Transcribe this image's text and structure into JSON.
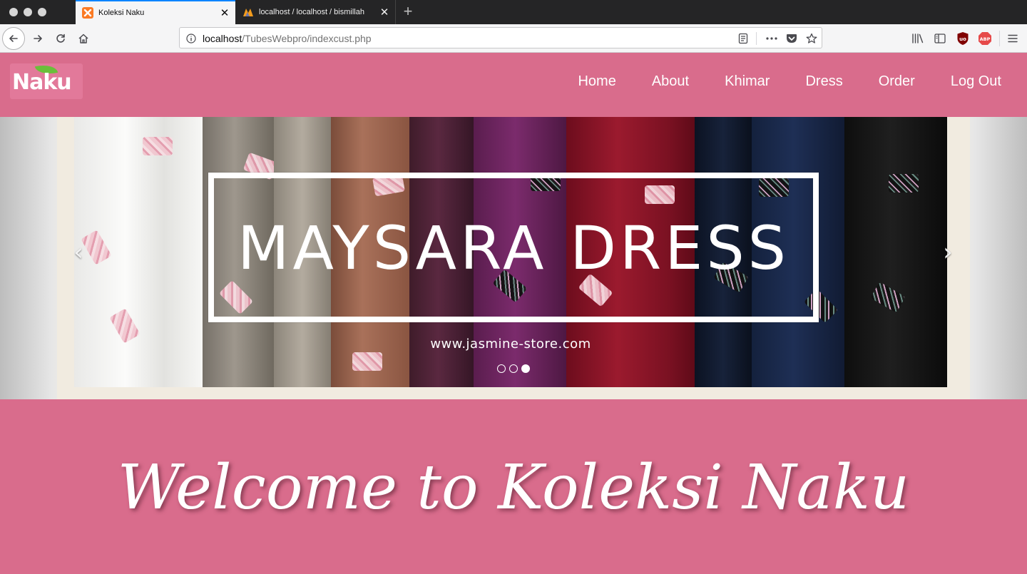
{
  "browser": {
    "tabs": [
      {
        "title": "Koleksi Naku",
        "active": true,
        "favicon": "xampp-icon"
      },
      {
        "title": "localhost / localhost / bismillah",
        "active": false,
        "favicon": "phpmyadmin-icon"
      }
    ],
    "url": {
      "host": "localhost",
      "path": "/TubesWebpro/indexcust.php"
    }
  },
  "site": {
    "logo_text": "Naku",
    "menu": [
      "Home",
      "About",
      "Khimar",
      "Dress",
      "Order",
      "Log Out"
    ]
  },
  "carousel": {
    "title": "MAYSARA DRESS",
    "subtitle": "www.jasmine-store.com",
    "slide_count": 3,
    "active_slide": 3,
    "prev_icon": "chevron-left-icon",
    "next_icon": "chevron-right-icon"
  },
  "welcome": {
    "heading": "Welcome to Koleksi Naku"
  },
  "colors": {
    "brand_pink": "#d96c8c",
    "tab_accent": "#0a84ff"
  }
}
